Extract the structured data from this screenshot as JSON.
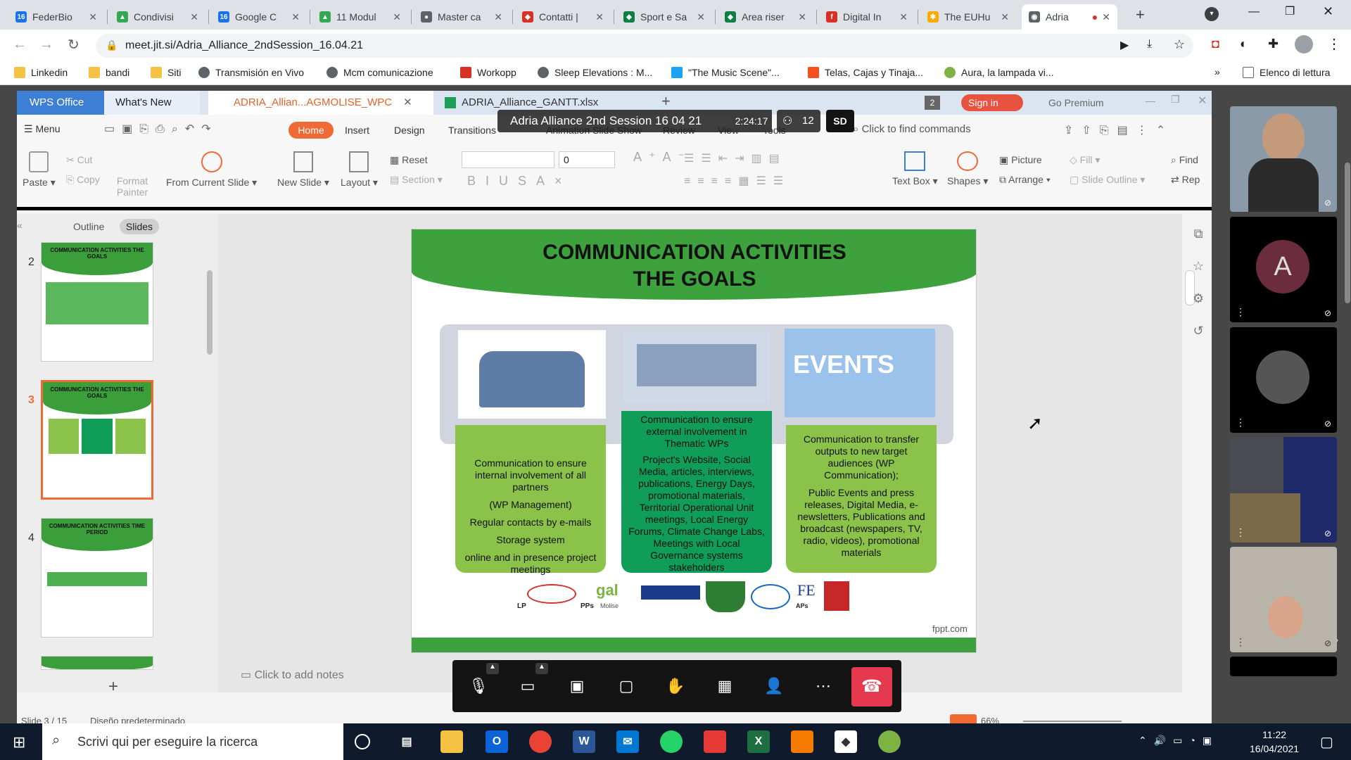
{
  "browser": {
    "tabs": [
      {
        "title": "FederBio",
        "color": "#1a73e8",
        "fav": "16"
      },
      {
        "title": "Condivisi",
        "color": "#34a853",
        "fav": "▲"
      },
      {
        "title": "Google C",
        "color": "#1a73e8",
        "fav": "16"
      },
      {
        "title": "11 Modul",
        "color": "#34a853",
        "fav": "▲"
      },
      {
        "title": "Master ca",
        "color": "#5f6368",
        "fav": "●"
      },
      {
        "title": "Contatti |",
        "color": "#d93025",
        "fav": "◆"
      },
      {
        "title": "Sport e Sa",
        "color": "#0b8043",
        "fav": "◆"
      },
      {
        "title": "Area riser",
        "color": "#0b8043",
        "fav": "◆"
      },
      {
        "title": "Digital In",
        "color": "#d93025",
        "fav": "f"
      },
      {
        "title": "The EUHu",
        "color": "#f9ab00",
        "fav": "✱"
      },
      {
        "title": "Adria",
        "color": "#5f6368",
        "fav": "◉"
      }
    ],
    "new_tab": "+",
    "url": "meet.jit.si/Adria_Alliance_2ndSession_16.04.21",
    "bookmarks": [
      {
        "label": "Linkedin",
        "color": "#f6c244"
      },
      {
        "label": "bandi",
        "color": "#f6c244"
      },
      {
        "label": "Siti",
        "color": "#f6c244"
      },
      {
        "label": "Transmisión en Vivo",
        "color": "#5f6368"
      },
      {
        "label": "Mcm comunicazione",
        "color": "#5f6368"
      },
      {
        "label": "Workopp",
        "color": "#d93025"
      },
      {
        "label": "Sleep Elevations : M...",
        "color": "#5f6368"
      },
      {
        "label": "\"The Music Scene\"...",
        "color": "#1da1f2"
      },
      {
        "label": "Telas, Cajas y Tinaja...",
        "color": "#f4511e"
      },
      {
        "label": "Aura, la lampada vi...",
        "color": "#7cb342"
      }
    ],
    "reading_list": "Elenco di lettura"
  },
  "meeting": {
    "title": "Adria Alliance 2nd Session 16 04 21",
    "duration": "2:24:17",
    "participants": "12",
    "quality": "SD"
  },
  "wps": {
    "app_tab": "WPS Office",
    "whats_new": "What's New",
    "doc_tab": "ADRIA_Allian...AGMOLISE_WPC",
    "xls_tab": "ADRIA_Alliance_GANTT.xlsx",
    "badge": "2",
    "sign_in": "Sign in",
    "go_premium": "Go Premium",
    "menu_label": "Menu",
    "menus": [
      "Home",
      "Insert",
      "Design",
      "Transitions",
      "Animation",
      "Slide Show",
      "Review",
      "View",
      "Tools"
    ],
    "search": "Click to find commands",
    "ribbon": {
      "paste": "Paste",
      "cut": "Cut",
      "copy": "Copy",
      "format_painter": "Format Painter",
      "from_current": "From Current Slide",
      "new_slide": "New Slide",
      "layout": "Layout",
      "reset": "Reset",
      "section": "Section",
      "font_size": "0",
      "text_box": "Text Box",
      "shapes": "Shapes",
      "picture": "Picture",
      "fill": "Fill",
      "arrange": "Arrange",
      "slide_outline": "Slide Outline",
      "find": "Find",
      "replace": "Rep"
    },
    "outline_tab": "Outline",
    "slides_tab": "Slides",
    "notes_placeholder": "Click to add notes",
    "status_slide": "Slide 3 / 15",
    "status_theme": "Diseño predeterminado",
    "zoom": "66%",
    "thumbs": [
      {
        "num": "2",
        "title": "COMMUNICATION ACTIVITIES THE GOALS"
      },
      {
        "num": "3",
        "title": "COMMUNICATION ACTIVITIES THE GOALS"
      },
      {
        "num": "4",
        "title": "COMMUNICATION ACTIVITIES TIME PERIOD"
      }
    ]
  },
  "slide": {
    "title1": "COMMUNICATION ACTIVITIES",
    "title2": "THE GOALS",
    "events_label": "EVENTS",
    "col1": {
      "p1": "Communication to ensure internal involvement of all partners",
      "p2": "(WP Management)",
      "p3": "Regular contacts by e-mails",
      "p4": "Storage system",
      "p5": "online and in presence project meetings"
    },
    "col2": {
      "p1": "Communication to ensure external involvement in Thematic WPs",
      "p2": "Project's Website, Social Media, articles, interviews, publications, Energy Days, promotional materials, Territorial Operational Unit meetings, Local Energy Forums, Climate Change Labs, Meetings with Local Governance systems stakeholders"
    },
    "col3": {
      "p1": "Communication to transfer outputs to new target audiences (WP Communication);",
      "p2": "Public Events and press releases, Digital Media, e-newsletters, Publications and broadcast (newspapers, TV, radio, videos), promotional materials"
    },
    "logo_lp": "LP",
    "logo_pps": "PPs",
    "logo_aps": "APs",
    "logo_gal": "gal",
    "logo_molise": "Molise",
    "footer": "fppt.com"
  },
  "participants_tiles": [
    {
      "kind": "video"
    },
    {
      "kind": "avatar",
      "letter": "A",
      "color": "#6b2c3e"
    },
    {
      "kind": "placeholder"
    },
    {
      "kind": "video"
    },
    {
      "kind": "video"
    }
  ],
  "taskbar": {
    "search_placeholder": "Scrivi qui per eseguire la ricerca",
    "time": "11:22",
    "date": "16/04/2021"
  }
}
